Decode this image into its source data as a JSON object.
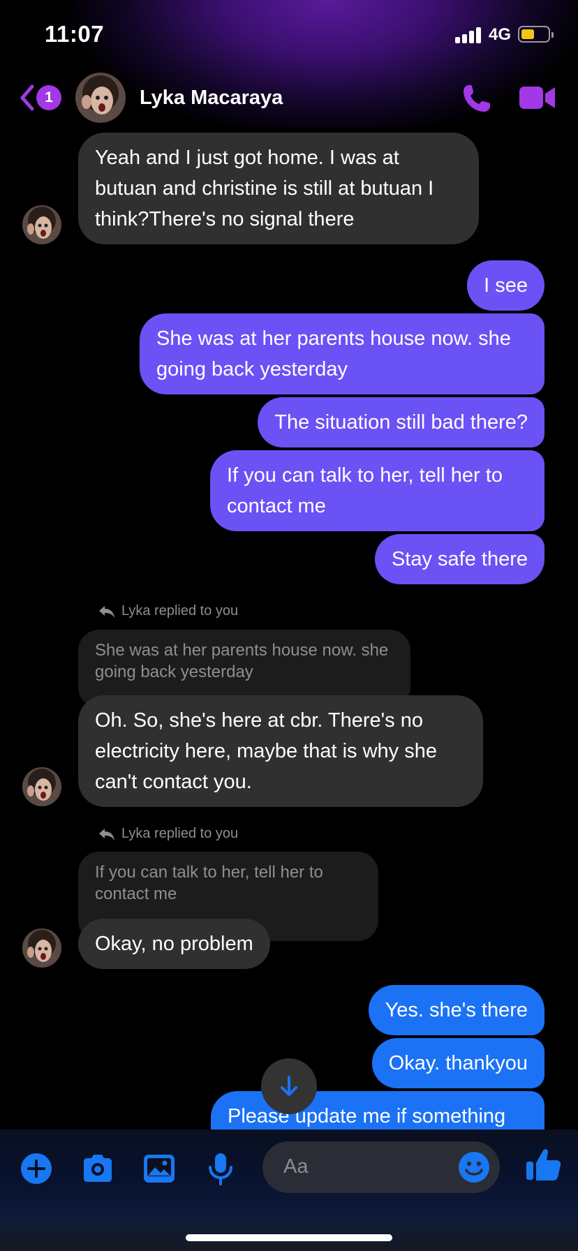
{
  "status_bar": {
    "time": "11:07",
    "network": "4G",
    "battery_level": 0.5
  },
  "header": {
    "back_badge": "1",
    "contact_name": "Lyka Macaraya"
  },
  "messages": {
    "m1": "Yeah and I just got home. I was at butuan and christine is still at butuan I think?There's no signal there",
    "m2": "I see",
    "m3": "She was at her parents house now. she going back yesterday",
    "m4": "The situation still bad there?",
    "m5": "If you can talk to her, tell her to contact me",
    "m6": "Stay safe there",
    "reply1_label": "Lyka replied to you",
    "reply1_quote": "She was at her parents house now. she going back yesterday",
    "m7": "Oh. So, she's here at cbr. There's no electricity here, maybe that is why she can't contact you.",
    "reply2_label": "Lyka replied to you",
    "reply2_quote": "If you can talk to her, tell her to contact me",
    "m8": "Okay, no problem",
    "m9": "Yes. she's there",
    "m10": "Okay. thankyou",
    "m11": "Please update me if something"
  },
  "composer": {
    "placeholder": "Aa"
  },
  "colors": {
    "accent_purple": "#a238e6",
    "outgoing_purple": "#6a52f5",
    "outgoing_blue": "#1b72f5",
    "incoming_gray": "#303030",
    "composer_blue": "#1877f2"
  },
  "icons": [
    "back-chevron-icon",
    "phone-icon",
    "video-camera-icon",
    "plus-icon",
    "camera-icon",
    "gallery-icon",
    "microphone-icon",
    "emoji-icon",
    "thumbs-up-icon",
    "arrow-down-icon",
    "reply-arrow-icon"
  ]
}
